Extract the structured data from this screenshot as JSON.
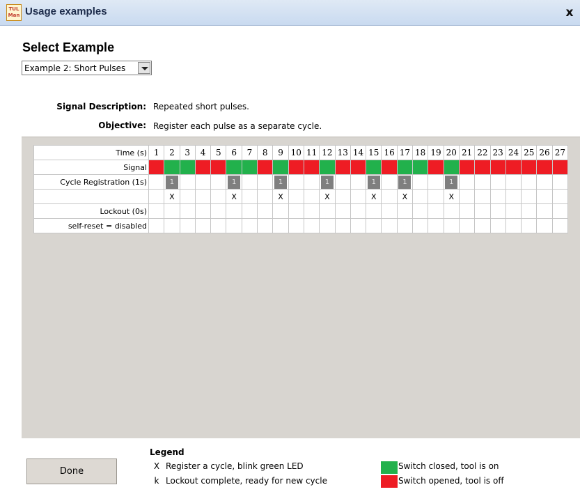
{
  "window": {
    "title": "Usage examples",
    "icon_text": "TUL Man",
    "close": "x"
  },
  "selector": {
    "heading": "Select Example",
    "selected": "Example 2: Short Pulses"
  },
  "description": {
    "signal_label": "Signal Description:",
    "signal_text": "Repeated short pulses.",
    "objective_label": "Objective:",
    "objective_text": "Register each pulse as a separate cycle."
  },
  "table": {
    "time_label": "Time (s)",
    "times": [
      "1",
      "2",
      "3",
      "4",
      "5",
      "6",
      "7",
      "8",
      "9",
      "10",
      "11",
      "12",
      "13",
      "14",
      "15",
      "16",
      "17",
      "18",
      "19",
      "20",
      "21",
      "22",
      "23",
      "24",
      "25",
      "26",
      "27"
    ],
    "signal_label": "Signal",
    "signal": [
      "off",
      "on",
      "on",
      "off",
      "off",
      "on",
      "on",
      "off",
      "on",
      "off",
      "off",
      "on",
      "off",
      "off",
      "on",
      "off",
      "on",
      "on",
      "off",
      "on",
      "off",
      "off",
      "off",
      "off",
      "off",
      "off",
      "off"
    ],
    "cycle_label": "Cycle Registration (1s)",
    "cycle": [
      "",
      "1",
      "",
      "",
      "",
      "1",
      "",
      "",
      "1",
      "",
      "",
      "1",
      "",
      "",
      "1",
      "",
      "1",
      "",
      "",
      "1",
      "",
      "",
      "",
      "",
      "",
      "",
      ""
    ],
    "x_row": [
      "",
      "X",
      "",
      "",
      "",
      "X",
      "",
      "",
      "X",
      "",
      "",
      "X",
      "",
      "",
      "X",
      "",
      "X",
      "",
      "",
      "X",
      "",
      "",
      "",
      "",
      "",
      "",
      ""
    ],
    "lockout_label": "Lockout (0s)",
    "selfreset_label": "self-reset = disabled"
  },
  "colors": {
    "on": "#22b14c",
    "off": "#ee1c24",
    "register": "#7f7f7f"
  },
  "done_label": "Done",
  "legend": {
    "title": "Legend",
    "items": [
      {
        "key": "X",
        "text": "Register a cycle, blink green LED"
      },
      {
        "key": "k",
        "text": "Lockout complete, ready for new cycle"
      }
    ],
    "swatches": [
      {
        "text": "Switch closed, tool is on"
      },
      {
        "text": "Switch opened, tool is off"
      }
    ]
  }
}
